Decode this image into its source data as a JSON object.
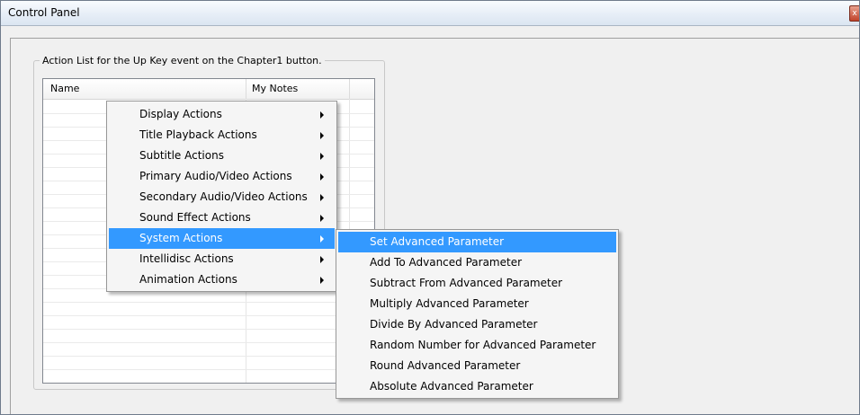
{
  "window": {
    "title": "Control Panel",
    "close_label": "x"
  },
  "group": {
    "label": "Action List for the Up Key event on the Chapter1 button."
  },
  "listview": {
    "columns": [
      "Name",
      "My Notes"
    ]
  },
  "context_menu": {
    "items": [
      "Display Actions",
      "Title Playback Actions",
      "Subtitle Actions",
      "Primary Audio/Video Actions",
      "Secondary Audio/Video Actions",
      "Sound Effect Actions",
      "System Actions",
      "Intellidisc Actions",
      "Animation Actions"
    ],
    "highlighted": "System Actions"
  },
  "submenu": {
    "items": [
      "Set Advanced Parameter",
      "Add To Advanced Parameter",
      "Subtract From Advanced Parameter",
      "Multiply Advanced Parameter",
      "Divide By Advanced Parameter",
      "Random Number for Advanced Parameter",
      "Round Advanced Parameter",
      "Absolute Advanced Parameter"
    ],
    "highlighted": "Set Advanced Parameter"
  },
  "colors": {
    "highlight": "#3399ff",
    "menu_bg": "#f5f5f5",
    "window_bg": "#f0f0f0"
  }
}
